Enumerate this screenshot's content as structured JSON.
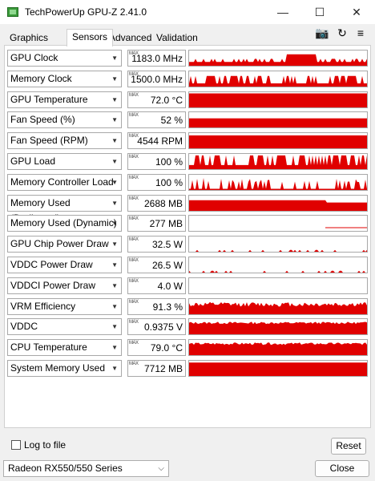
{
  "window": {
    "title": "TechPowerUp GPU-Z 2.41.0",
    "minimize": "—",
    "maximize": "☐",
    "close": "✕"
  },
  "tabs": [
    "Graphics Card",
    "Sensors",
    "Advanced",
    "Validation"
  ],
  "toolbar": {
    "camera": "📷",
    "refresh": "↻",
    "menu": "≡"
  },
  "max_tag": "MAX",
  "sensors": [
    {
      "label": "GPU Clock",
      "value": "1183.0 MHz",
      "graph": "spiky-high",
      "level": 0.75
    },
    {
      "label": "Memory Clock",
      "value": "1500.0 MHz",
      "graph": "spiky-full",
      "level": 0.7
    },
    {
      "label": "GPU Temperature",
      "value": "72.0 °C",
      "graph": "solid",
      "level": 0.92
    },
    {
      "label": "Fan Speed (%)",
      "value": "52 %",
      "graph": "solid",
      "level": 0.6
    },
    {
      "label": "Fan Speed (RPM)",
      "value": "4544 RPM",
      "graph": "solid",
      "level": 0.85
    },
    {
      "label": "GPU Load",
      "value": "100 %",
      "graph": "spiky-full",
      "level": 0.9
    },
    {
      "label": "Memory Controller Load",
      "value": "100 %",
      "graph": "spiky-low",
      "level": 0.5
    },
    {
      "label": "Memory Used (Dedicated)",
      "value": "2688 MB",
      "graph": "solid-drop",
      "level": 0.7
    },
    {
      "label": "Memory Used (Dynamic)",
      "value": "277 MB",
      "graph": "line-tail",
      "level": 0.1
    },
    {
      "label": "GPU Chip Power Draw",
      "value": "32.5 W",
      "graph": "sparse-low",
      "level": 0.1
    },
    {
      "label": "VDDC Power Draw",
      "value": "26.5 W",
      "graph": "sparse-low",
      "level": 0.08
    },
    {
      "label": "VDDCI Power Draw",
      "value": "4.0 W",
      "graph": "empty",
      "level": 0
    },
    {
      "label": "VRM Efficiency",
      "value": "91.3 %",
      "graph": "noisy-high",
      "level": 0.65
    },
    {
      "label": "VDDC",
      "value": "0.9375 V",
      "graph": "noisy-mid",
      "level": 0.75
    },
    {
      "label": "CPU Temperature",
      "value": "79.0 °C",
      "graph": "noisy-mid",
      "level": 0.75
    },
    {
      "label": "System Memory Used",
      "value": "7712 MB",
      "graph": "solid",
      "level": 0.88
    }
  ],
  "log_to_file": "Log to file",
  "reset": "Reset",
  "device_select": "Radeon RX550/550 Series",
  "close_button": "Close",
  "colors": {
    "graph": "#e00000",
    "border": "#a8a8a8"
  }
}
